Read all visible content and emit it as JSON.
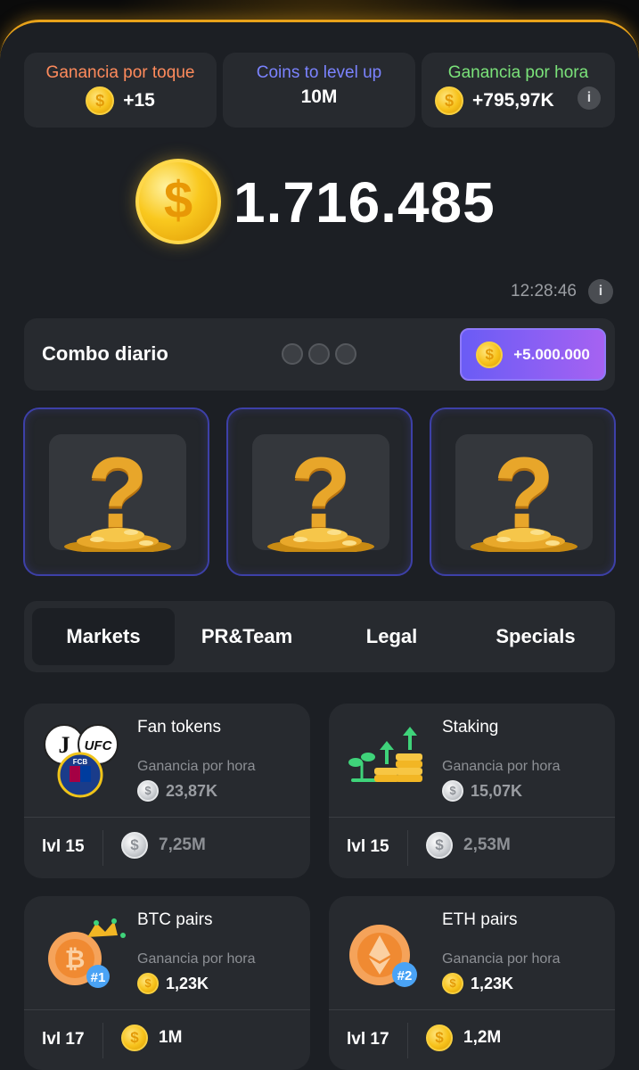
{
  "stats": {
    "tap": {
      "label": "Ganancia por toque",
      "value": "+15",
      "color": "#ff8b5c"
    },
    "level": {
      "label": "Coins to level up",
      "value": "10M",
      "color": "#7b83ff"
    },
    "hour": {
      "label": "Ganancia por hora",
      "value": "+795,97K",
      "color": "#7be37a"
    }
  },
  "balance": "1.716.485",
  "timer": "12:28:46",
  "combo": {
    "title": "Combo diario",
    "reward": "+5.000.000"
  },
  "tabs": [
    "Markets",
    "PR&Team",
    "Legal",
    "Specials"
  ],
  "upgrades": [
    {
      "name": "Fan tokens",
      "gph_label": "Ganancia por hora",
      "rate": "23,87K",
      "lvl": "lvl 15",
      "cost": "7,25M"
    },
    {
      "name": "Staking",
      "gph_label": "Ganancia por hora",
      "rate": "15,07K",
      "lvl": "lvl 15",
      "cost": "2,53M"
    },
    {
      "name": "BTC pairs",
      "gph_label": "Ganancia por hora",
      "rate": "1,23K",
      "lvl": "lvl 17",
      "cost": "1M"
    },
    {
      "name": "ETH pairs",
      "gph_label": "Ganancia por hora",
      "rate": "1,23K",
      "lvl": "lvl 17",
      "cost": "1,2M"
    }
  ],
  "icons": {
    "coin": "coin-icon",
    "info": "info-icon",
    "question": "mystery-card-icon",
    "fan_tokens_badges": [
      "J",
      "UFC",
      "FCB"
    ],
    "btc_badge": "#1",
    "eth_badge": "#2"
  }
}
